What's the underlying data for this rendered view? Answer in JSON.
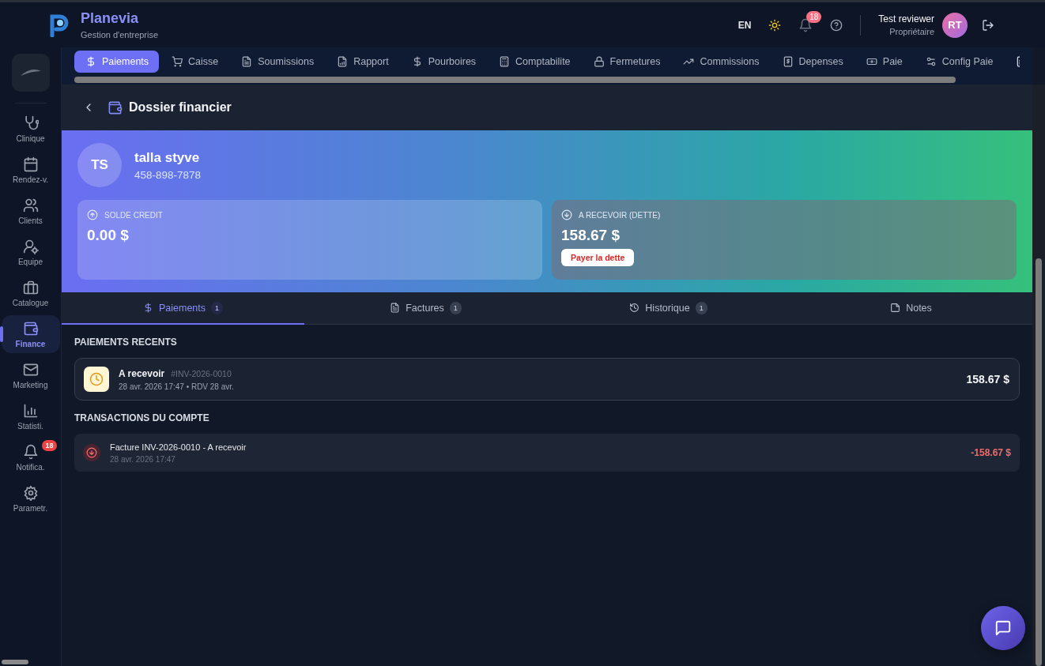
{
  "header": {
    "app_name": "Planevia",
    "subtitle": "Gestion d'entreprise",
    "language": "EN",
    "notification_count": "18",
    "user_name": "Test reviewer",
    "user_role": "Propriétaire",
    "user_initials": "RT"
  },
  "sidebar": {
    "items": [
      {
        "label": "Clinique",
        "selected": false
      },
      {
        "label": "Rendez-v.",
        "selected": false
      },
      {
        "label": "Clients",
        "selected": false
      },
      {
        "label": "Equipe",
        "selected": false
      },
      {
        "label": "Catalogue",
        "selected": false
      },
      {
        "label": "Finance",
        "selected": true
      },
      {
        "label": "Marketing",
        "selected": false
      },
      {
        "label": "Statisti.",
        "selected": false
      },
      {
        "label": "Notifica.",
        "selected": false,
        "badge": "18"
      },
      {
        "label": "Parametr.",
        "selected": false
      }
    ]
  },
  "module_tabs": [
    {
      "label": "Paiements",
      "selected": true
    },
    {
      "label": "Caisse",
      "selected": false
    },
    {
      "label": "Soumissions",
      "selected": false
    },
    {
      "label": "Rapport",
      "selected": false
    },
    {
      "label": "Pourboires",
      "selected": false
    },
    {
      "label": "Comptabilite",
      "selected": false
    },
    {
      "label": "Fermetures",
      "selected": false
    },
    {
      "label": "Commissions",
      "selected": false
    },
    {
      "label": "Depenses",
      "selected": false
    },
    {
      "label": "Paie",
      "selected": false
    },
    {
      "label": "Config Paie",
      "selected": false
    }
  ],
  "page": {
    "title": "Dossier financier"
  },
  "client": {
    "initials": "TS",
    "name": "talla styve",
    "phone": "458-898-7878"
  },
  "balances": [
    {
      "label": "SOLDE CREDIT",
      "amount": "0.00 $"
    },
    {
      "label": "A RECEVOIR (DETTE)",
      "amount": "158.67 $",
      "action": "Payer la dette"
    }
  ],
  "detail_tabs": [
    {
      "label": "Paiements",
      "count": "1",
      "selected": true
    },
    {
      "label": "Factures",
      "count": "1",
      "selected": false
    },
    {
      "label": "Historique",
      "count": "1",
      "selected": false
    },
    {
      "label": "Notes",
      "selected": false
    }
  ],
  "recent_payments": {
    "title": "PAIEMENTS RECENTS",
    "items": [
      {
        "status": "A recevoir",
        "reference": "#INV-2026-0010",
        "details": "28 avr. 2026 17:47 • RDV 28 avr.",
        "amount": "158.67 $"
      }
    ]
  },
  "transactions": {
    "title": "TRANSACTIONS DU COMPTE",
    "items": [
      {
        "description": "Facture INV-2026-0010 - A recevoir",
        "date": "28 avr. 2026 17:47",
        "amount": "-158.67 $"
      }
    ]
  }
}
